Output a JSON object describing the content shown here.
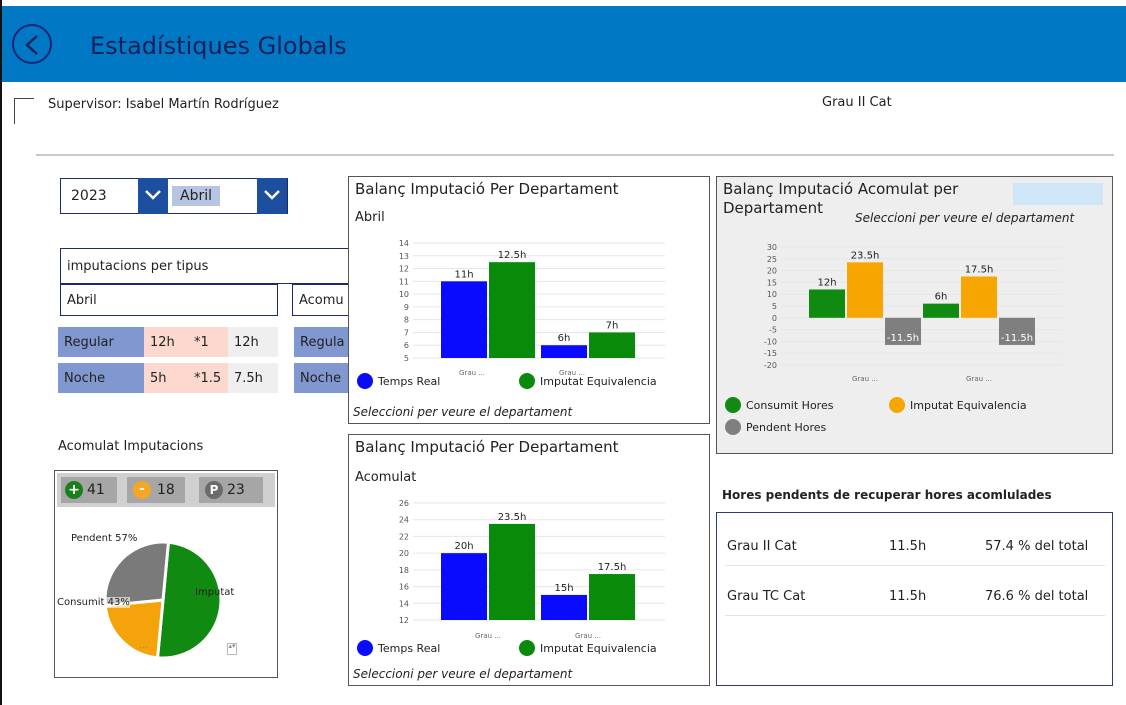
{
  "header": {
    "title": "Estadístiques Globals"
  },
  "supervisor": "Supervisor: Isabel Martín Rodríguez",
  "group_label": "Grau II Cat",
  "filters": {
    "year": "2023",
    "month": "Abril"
  },
  "imputacions": {
    "title": "imputacions per tipus",
    "month_box": "Abril",
    "acum_box": "Acomu",
    "rows": [
      {
        "type": "Regular",
        "hours": "12h",
        "factor": "*1",
        "result": "12h",
        "type2": "Regula"
      },
      {
        "type": "Noche",
        "hours": "5h",
        "factor": "*1.5",
        "result": "7.5h",
        "type2": "Noche"
      }
    ]
  },
  "acomulat": {
    "title": "Acomulat Imputacions",
    "badges": [
      {
        "icon": "plus",
        "value": "41",
        "color": "#1a7f1a"
      },
      {
        "icon": "minus",
        "value": "18",
        "color": "#f5a623"
      },
      {
        "icon": "P",
        "value": "23",
        "color": "#6b6b6b"
      }
    ],
    "pie_labels": {
      "pendent": "Pendent 57%",
      "consumit": "Consumit 43%",
      "imputat": "Imputat"
    },
    "pie": [
      {
        "name": "Imputat",
        "value": 41,
        "color": "#108a10"
      },
      {
        "name": "Consumit",
        "value": 18,
        "color": "#f5a30a"
      },
      {
        "name": "Pendent",
        "value": 23,
        "color": "#7a7a7a"
      }
    ]
  },
  "chart_data": [
    {
      "type": "bar",
      "title": "Balanç Imputació Per Departament",
      "subtitle": "Abril",
      "categories": [
        "Grau ...",
        "Grau ..."
      ],
      "series": [
        {
          "name": "Temps Real",
          "values": [
            11,
            6
          ],
          "labels": [
            "11h",
            "6h"
          ],
          "color": "#0a0aff"
        },
        {
          "name": "Imputat Equivalencia",
          "values": [
            12.5,
            7
          ],
          "labels": [
            "12.5h",
            "7h"
          ],
          "color": "#0a8a0a"
        }
      ],
      "ylim": [
        5,
        14
      ],
      "yticks": [
        "5",
        "6",
        "7",
        "8",
        "9",
        "10",
        "11",
        "12",
        "13",
        "14"
      ],
      "note": "Seleccioni per veure el departament"
    },
    {
      "type": "bar",
      "title": "Balanç Imputació Per Departament",
      "subtitle": "Acomulat",
      "categories": [
        "Grau ...",
        "Grau ..."
      ],
      "series": [
        {
          "name": "Temps Real",
          "values": [
            20,
            15
          ],
          "labels": [
            "20h",
            "15h"
          ],
          "color": "#0a0aff"
        },
        {
          "name": "Imputat Equivalencia",
          "values": [
            23.5,
            17.5
          ],
          "labels": [
            "23.5h",
            "17.5h"
          ],
          "color": "#0a8a0a"
        }
      ],
      "ylim": [
        12,
        26
      ],
      "yticks": [
        "12",
        "14",
        "16",
        "18",
        "20",
        "22",
        "24",
        "26"
      ],
      "note": "Seleccioni per veure el departament"
    },
    {
      "type": "bar",
      "title": "Balanç Imputació Acomulat per Departament",
      "note": "Seleccioni per veure el departament",
      "categories": [
        "Grau ...",
        "Grau ..."
      ],
      "series": [
        {
          "name": "Consumit Hores",
          "values": [
            12,
            6
          ],
          "labels": [
            "12h",
            "6h"
          ],
          "color": "#108a10"
        },
        {
          "name": "Imputat Equivalencia",
          "values": [
            23.5,
            17.5
          ],
          "labels": [
            "23.5h",
            "17.5h"
          ],
          "color": "#f7a500"
        },
        {
          "name": "Pendent Hores",
          "values": [
            -11.5,
            -11.5
          ],
          "labels": [
            "-11.5h",
            "-11.5h"
          ],
          "color": "#7f7f7f"
        }
      ],
      "ylim": [
        -20,
        30
      ],
      "yticks": [
        "30",
        "25",
        "20",
        "15",
        "10",
        "5",
        "0",
        "-5",
        "-10",
        "-15",
        "-20"
      ]
    }
  ],
  "pending": {
    "title": "Hores pendents de recuperar hores acomlulades",
    "rows": [
      {
        "name": "Grau II Cat",
        "hours": "11.5h",
        "pct": "57.4  % del total"
      },
      {
        "name": "Grau TC Cat",
        "hours": "11.5h",
        "pct": "76.6  % del total"
      }
    ]
  }
}
